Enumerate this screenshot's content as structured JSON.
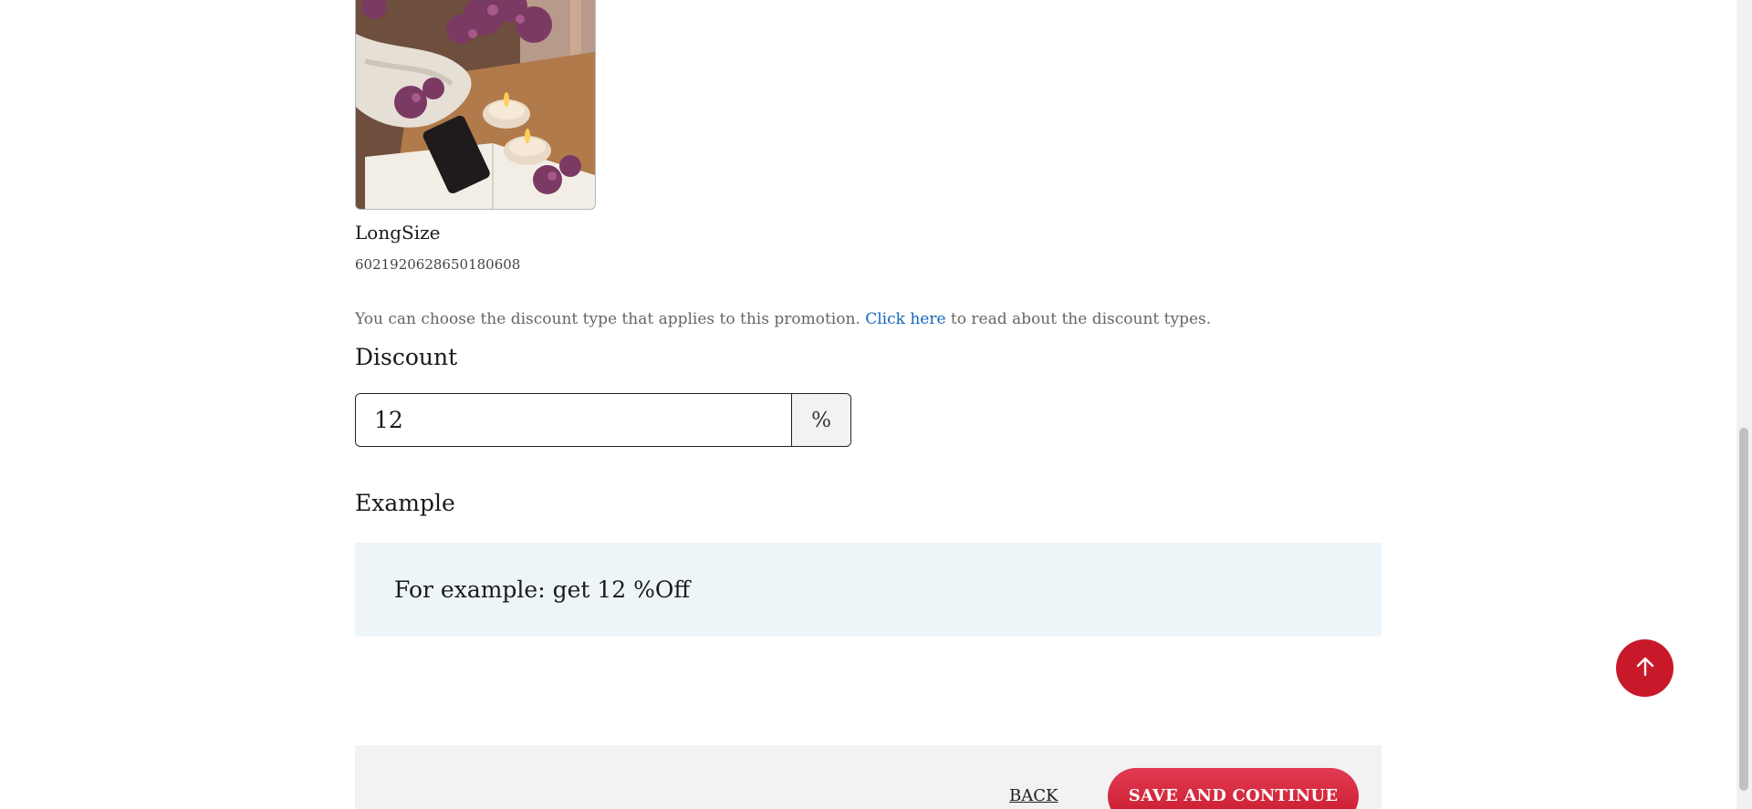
{
  "product": {
    "image_alt": "Candles, lilac flowers and an open book",
    "name": "LongSize",
    "code": "6021920628650180608"
  },
  "info": {
    "before_link": "You can choose the discount type that applies to this promotion. ",
    "link_text": "Click here",
    "after_link": " to read about the discount types."
  },
  "discount": {
    "title": "Discount",
    "value": "12",
    "suffix": "%"
  },
  "example": {
    "title": "Example",
    "text": "For example: get 12 %Off"
  },
  "footer": {
    "back_label": "BACK",
    "save_label": "SAVE AND CONTINUE"
  },
  "colors": {
    "accent": "#c8192b",
    "link": "#1466b8",
    "example_bg": "#eef5f9"
  },
  "icons": {
    "scroll_top": "arrow-up-icon"
  }
}
